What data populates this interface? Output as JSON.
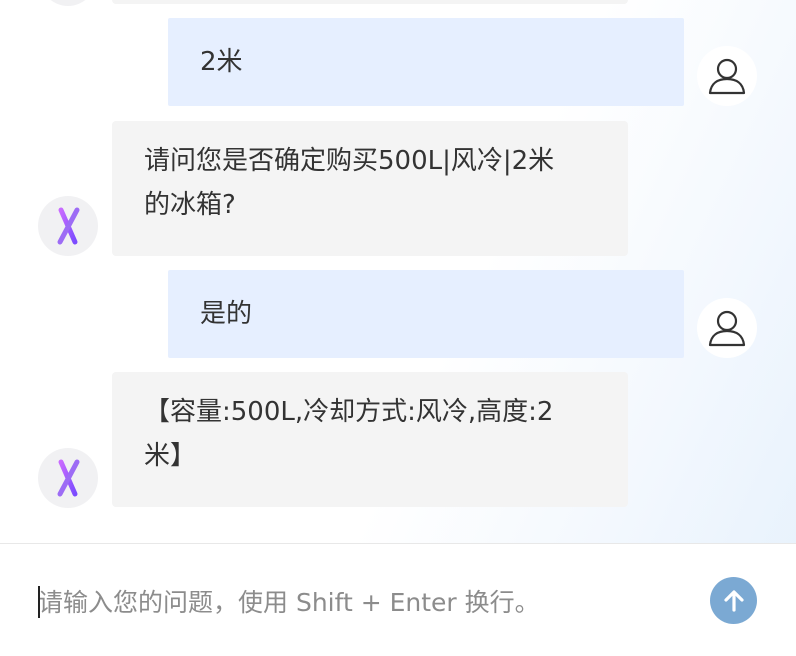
{
  "messages": [
    {
      "role": "user",
      "text": "2米"
    },
    {
      "role": "assistant",
      "lines": [
        "请问您是否确定购买500L|风冷|2米",
        "的冰箱?"
      ]
    },
    {
      "role": "user",
      "text": "是的"
    },
    {
      "role": "assistant",
      "lines": [
        "【容量:500L,冷却方式:风冷,高度:2",
        "米】"
      ]
    }
  ],
  "input": {
    "placeholder": "请输入您的问题，使用 Shift + Enter 换行。",
    "value": ""
  },
  "icons": {
    "user_avatar": "user-outline-icon",
    "bot_avatar": "asterisk-logo-icon",
    "send": "arrow-up-icon"
  },
  "colors": {
    "user_bubble": "#e6efff",
    "bot_bubble": "#f4f4f4",
    "send_button": "#7ba9d3"
  }
}
